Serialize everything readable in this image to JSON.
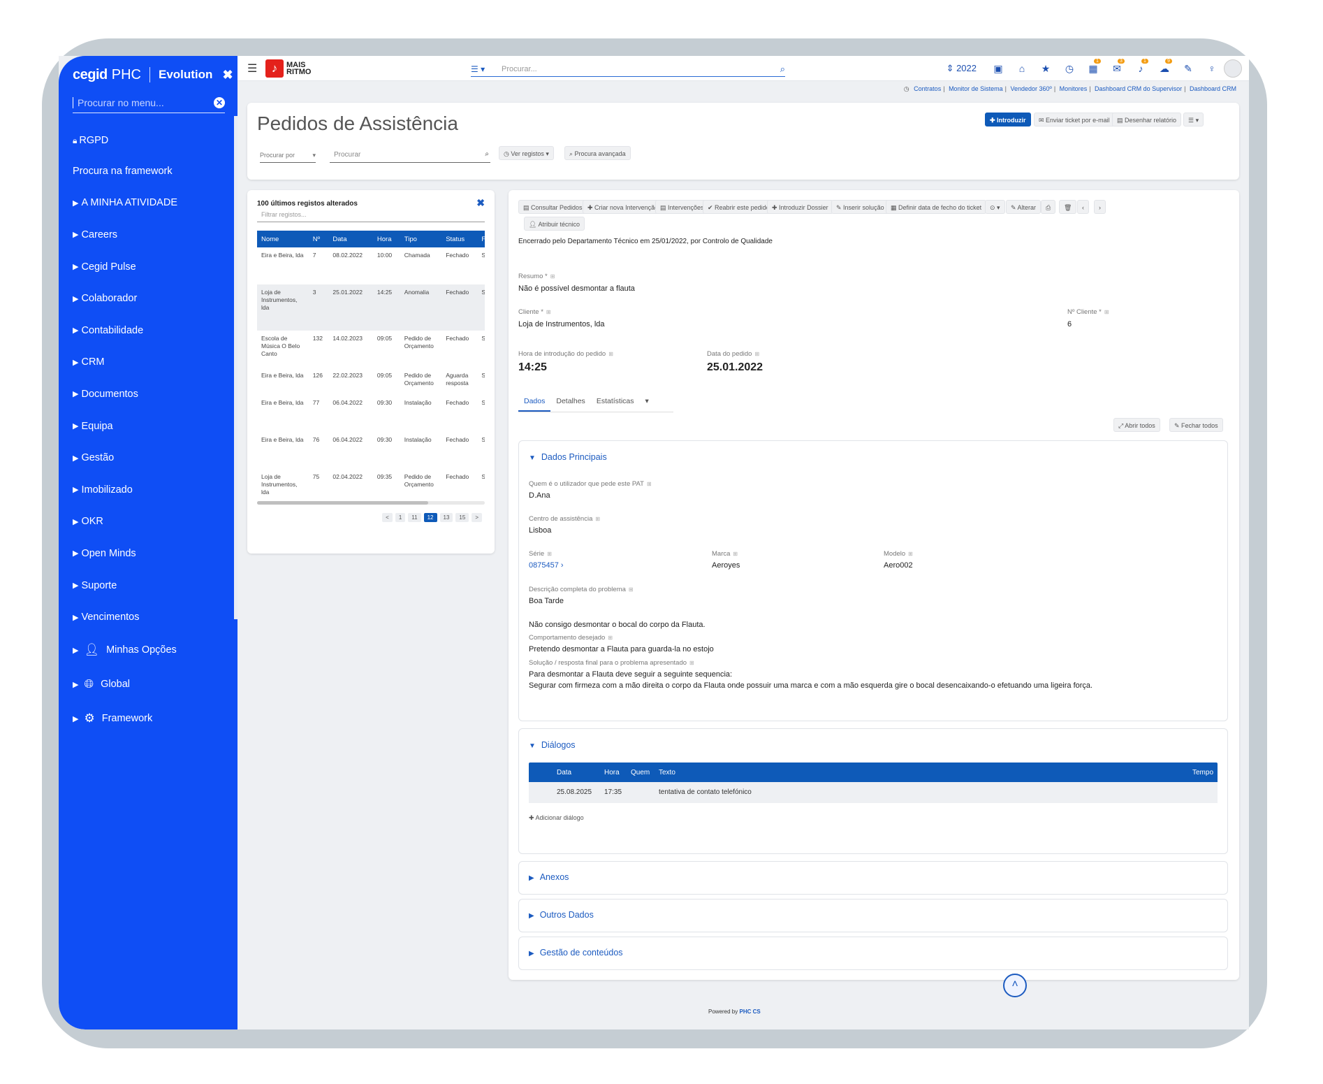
{
  "sidebar": {
    "brand_cegid": "cegid",
    "brand_phc": "PHC",
    "brand_evolution": "Evolution",
    "search_placeholder": "Procurar no menu...",
    "items": [
      {
        "label": "RGPD",
        "icon": "lock-icon"
      },
      {
        "label": "Procura na framework"
      },
      {
        "label": "A MINHA ATIVIDADE"
      },
      {
        "label": "Careers"
      },
      {
        "label": "Cegid Pulse"
      },
      {
        "label": "Colaborador"
      },
      {
        "label": "Contabilidade"
      },
      {
        "label": "CRM"
      },
      {
        "label": "Documentos"
      },
      {
        "label": "Equipa"
      },
      {
        "label": "Gestão"
      },
      {
        "label": "Imobilizado"
      },
      {
        "label": "OKR"
      },
      {
        "label": "Open Minds"
      },
      {
        "label": "Suporte"
      },
      {
        "label": "Vencimentos"
      },
      {
        "label": "Minhas Opções",
        "icon": "user-icon"
      },
      {
        "label": "Global",
        "icon": "globe-icon"
      },
      {
        "label": "Framework",
        "icon": "gears-icon"
      }
    ]
  },
  "topbar": {
    "logo_line1": "MAIS",
    "logo_line2": "RITMO",
    "search_placeholder": "Procurar...",
    "year": "2022",
    "badges": [
      "1",
      "3",
      "1",
      "9"
    ]
  },
  "shortcuts": [
    "Contratos",
    "Monitor de Sistema",
    "Vendedor 360º",
    "Monitores",
    "Dashboard CRM do Supervisor",
    "Dashboard CRM"
  ],
  "header": {
    "title": "Pedidos de Assistência",
    "search_by": "Procurar por",
    "search_placeholder": "Procurar",
    "view_records": "Ver registos",
    "advanced_search": "Procura avançada",
    "btn_new": "Introduzir",
    "btn_email": "Enviar ticket por e-mail",
    "btn_report": "Desenhar relatório"
  },
  "records": {
    "title": "100 últimos registos alterados",
    "filter_placeholder": "Filtrar registos...",
    "columns": [
      "Nome",
      "Nº",
      "Data",
      "Hora",
      "Tipo",
      "Status",
      "Fe"
    ],
    "rows": [
      {
        "nome": "Eira e Beira, lda",
        "num": "7",
        "data": "08.02.2022",
        "hora": "10:00",
        "tipo": "Chamada",
        "status": "Fechado",
        "fe": "Sir"
      },
      {
        "nome": "Loja de Instrumentos, lda",
        "num": "3",
        "data": "25.01.2022",
        "hora": "14:25",
        "tipo": "Anomalia",
        "status": "Fechado",
        "fe": "Sir"
      },
      {
        "nome": "Escola de Música O Belo Canto",
        "num": "132",
        "data": "14.02.2023",
        "hora": "09:05",
        "tipo": "Pedido de Orçamento",
        "status": "Fechado",
        "fe": "Sir"
      },
      {
        "nome": "Eira e Beira, lda",
        "num": "126",
        "data": "22.02.2023",
        "hora": "09:05",
        "tipo": "Pedido de Orçamento",
        "status": "Aguarda resposta",
        "fe": "Sir"
      },
      {
        "nome": "Eira e Beira, lda",
        "num": "77",
        "data": "06.04.2022",
        "hora": "09:30",
        "tipo": "Instalação",
        "status": "Fechado",
        "fe": "Sir"
      },
      {
        "nome": "Eira e Beira, lda",
        "num": "76",
        "data": "06.04.2022",
        "hora": "09:30",
        "tipo": "Instalação",
        "status": "Fechado",
        "fe": "Sir"
      },
      {
        "nome": "Loja de Instrumentos, lda",
        "num": "75",
        "data": "02.04.2022",
        "hora": "09:35",
        "tipo": "Pedido de Orçamento",
        "status": "Fechado",
        "fe": "Sir"
      }
    ],
    "pages": [
      "<",
      "1",
      "11",
      "12",
      "13",
      "15",
      ">"
    ],
    "current_page": "12"
  },
  "toolbar": {
    "consultar": "Consultar Pedidos",
    "criar": "Criar nova Intervenção",
    "intervencoes": "Intervenções",
    "reabrir": "Reabrir este pedido",
    "dossier": "Introduzir Dossier",
    "solucao": "Inserir solução",
    "fecho": "Definir data de fecho do ticket",
    "alterar": "Alterar",
    "atribuir": "Atribuir técnico"
  },
  "detail": {
    "closed_note": "Encerrado pelo Departamento Técnico em 25/01/2022, por Controlo de Qualidade",
    "resumo_label": "Resumo *",
    "resumo": "Não é possível desmontar a flauta",
    "cliente_label": "Cliente *",
    "cliente": "Loja de Instrumentos, lda",
    "ncliente_label": "Nº Cliente *",
    "ncliente": "6",
    "hora_label": "Hora de introdução do pedido",
    "hora": "14:25",
    "data_label": "Data do pedido",
    "data": "25.01.2022",
    "tabs": [
      "Dados",
      "Detalhes",
      "Estatísticas"
    ],
    "open_all": "Abrir todos",
    "close_all": "Fechar todos"
  },
  "principais": {
    "title": "Dados Principais",
    "quem_label": "Quem é o utilizador que pede este PAT",
    "quem": "D.Ana",
    "centro_label": "Centro de assistência",
    "centro": "Lisboa",
    "serie_label": "Série",
    "serie": "0875457",
    "marca_label": "Marca",
    "marca": "Aeroyes",
    "modelo_label": "Modelo",
    "modelo": "Aero002",
    "desc_label": "Descrição completa do problema",
    "desc1": "Boa Tarde",
    "desc2": "Não consigo desmontar o bocal do corpo da Flauta.",
    "comp_label": "Comportamento desejado",
    "comp": "Pretendo desmontar a Flauta para guarda-la no estojo",
    "sol_label": "Solução / resposta final para o problema apresentado",
    "sol1": "Para desmontar a Flauta deve seguir a seguinte sequencia:",
    "sol2": "Segurar com firmeza com a mão direita o corpo da Flauta onde possuir uma marca e com a mão esquerda gire o bocal desencaixando-o efetuando uma ligeira força."
  },
  "dialogos": {
    "title": "Diálogos",
    "columns": {
      "data": "Data",
      "hora": "Hora",
      "quem": "Quem",
      "texto": "Texto",
      "tempo": "Tempo"
    },
    "row": {
      "data": "25.08.2025",
      "hora": "17:35",
      "quem": "",
      "texto": "tentativa de contato telefónico",
      "tempo": ""
    },
    "add": "Adicionar diálogo"
  },
  "sections": {
    "anexos": "Anexos",
    "outros": "Outros Dados",
    "gestao": "Gestão de conteúdos"
  },
  "footer": {
    "powered": "Powered by",
    "brand": "PHC CS"
  },
  "colors": {
    "sidebar": "#0f4ef5",
    "primary": "#0e5ab8",
    "link": "#1c5bc0"
  }
}
